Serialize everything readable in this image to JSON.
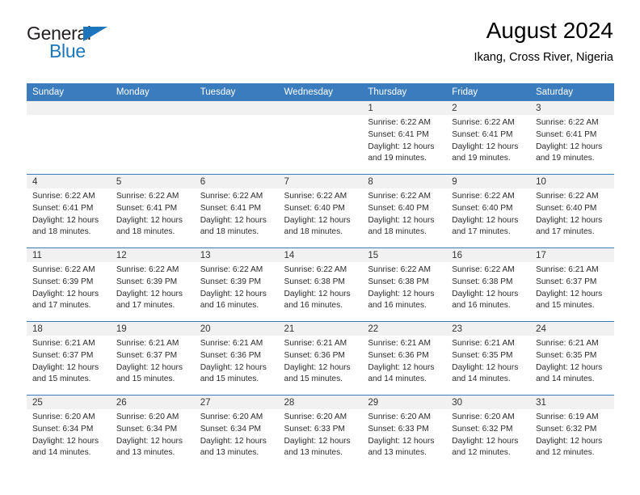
{
  "brand": {
    "name_part1": "General",
    "name_part2": "Blue",
    "triangle_icon": "blue-triangle-icon",
    "color_dark": "#231f20",
    "color_blue": "#1d76bc"
  },
  "header": {
    "title": "August 2024",
    "subtitle": "Ikang, Cross River, Nigeria"
  },
  "theme": {
    "header_row_bg": "#3a7cbe",
    "daynum_bg": "#f1f1f1",
    "grid_line": "#3a7cbe"
  },
  "weekday_headers": [
    "Sunday",
    "Monday",
    "Tuesday",
    "Wednesday",
    "Thursday",
    "Friday",
    "Saturday"
  ],
  "weeks": [
    [
      {
        "day": "",
        "empty": true,
        "sunrise": "",
        "sunset": "",
        "daylight1": "",
        "daylight2": ""
      },
      {
        "day": "",
        "empty": true,
        "sunrise": "",
        "sunset": "",
        "daylight1": "",
        "daylight2": ""
      },
      {
        "day": "",
        "empty": true,
        "sunrise": "",
        "sunset": "",
        "daylight1": "",
        "daylight2": ""
      },
      {
        "day": "",
        "empty": true,
        "sunrise": "",
        "sunset": "",
        "daylight1": "",
        "daylight2": ""
      },
      {
        "day": "1",
        "empty": false,
        "sunrise": "Sunrise: 6:22 AM",
        "sunset": "Sunset: 6:41 PM",
        "daylight1": "Daylight: 12 hours",
        "daylight2": "and 19 minutes."
      },
      {
        "day": "2",
        "empty": false,
        "sunrise": "Sunrise: 6:22 AM",
        "sunset": "Sunset: 6:41 PM",
        "daylight1": "Daylight: 12 hours",
        "daylight2": "and 19 minutes."
      },
      {
        "day": "3",
        "empty": false,
        "sunrise": "Sunrise: 6:22 AM",
        "sunset": "Sunset: 6:41 PM",
        "daylight1": "Daylight: 12 hours",
        "daylight2": "and 19 minutes."
      }
    ],
    [
      {
        "day": "4",
        "empty": false,
        "sunrise": "Sunrise: 6:22 AM",
        "sunset": "Sunset: 6:41 PM",
        "daylight1": "Daylight: 12 hours",
        "daylight2": "and 18 minutes."
      },
      {
        "day": "5",
        "empty": false,
        "sunrise": "Sunrise: 6:22 AM",
        "sunset": "Sunset: 6:41 PM",
        "daylight1": "Daylight: 12 hours",
        "daylight2": "and 18 minutes."
      },
      {
        "day": "6",
        "empty": false,
        "sunrise": "Sunrise: 6:22 AM",
        "sunset": "Sunset: 6:41 PM",
        "daylight1": "Daylight: 12 hours",
        "daylight2": "and 18 minutes."
      },
      {
        "day": "7",
        "empty": false,
        "sunrise": "Sunrise: 6:22 AM",
        "sunset": "Sunset: 6:40 PM",
        "daylight1": "Daylight: 12 hours",
        "daylight2": "and 18 minutes."
      },
      {
        "day": "8",
        "empty": false,
        "sunrise": "Sunrise: 6:22 AM",
        "sunset": "Sunset: 6:40 PM",
        "daylight1": "Daylight: 12 hours",
        "daylight2": "and 18 minutes."
      },
      {
        "day": "9",
        "empty": false,
        "sunrise": "Sunrise: 6:22 AM",
        "sunset": "Sunset: 6:40 PM",
        "daylight1": "Daylight: 12 hours",
        "daylight2": "and 17 minutes."
      },
      {
        "day": "10",
        "empty": false,
        "sunrise": "Sunrise: 6:22 AM",
        "sunset": "Sunset: 6:40 PM",
        "daylight1": "Daylight: 12 hours",
        "daylight2": "and 17 minutes."
      }
    ],
    [
      {
        "day": "11",
        "empty": false,
        "sunrise": "Sunrise: 6:22 AM",
        "sunset": "Sunset: 6:39 PM",
        "daylight1": "Daylight: 12 hours",
        "daylight2": "and 17 minutes."
      },
      {
        "day": "12",
        "empty": false,
        "sunrise": "Sunrise: 6:22 AM",
        "sunset": "Sunset: 6:39 PM",
        "daylight1": "Daylight: 12 hours",
        "daylight2": "and 17 minutes."
      },
      {
        "day": "13",
        "empty": false,
        "sunrise": "Sunrise: 6:22 AM",
        "sunset": "Sunset: 6:39 PM",
        "daylight1": "Daylight: 12 hours",
        "daylight2": "and 16 minutes."
      },
      {
        "day": "14",
        "empty": false,
        "sunrise": "Sunrise: 6:22 AM",
        "sunset": "Sunset: 6:38 PM",
        "daylight1": "Daylight: 12 hours",
        "daylight2": "and 16 minutes."
      },
      {
        "day": "15",
        "empty": false,
        "sunrise": "Sunrise: 6:22 AM",
        "sunset": "Sunset: 6:38 PM",
        "daylight1": "Daylight: 12 hours",
        "daylight2": "and 16 minutes."
      },
      {
        "day": "16",
        "empty": false,
        "sunrise": "Sunrise: 6:22 AM",
        "sunset": "Sunset: 6:38 PM",
        "daylight1": "Daylight: 12 hours",
        "daylight2": "and 16 minutes."
      },
      {
        "day": "17",
        "empty": false,
        "sunrise": "Sunrise: 6:21 AM",
        "sunset": "Sunset: 6:37 PM",
        "daylight1": "Daylight: 12 hours",
        "daylight2": "and 15 minutes."
      }
    ],
    [
      {
        "day": "18",
        "empty": false,
        "sunrise": "Sunrise: 6:21 AM",
        "sunset": "Sunset: 6:37 PM",
        "daylight1": "Daylight: 12 hours",
        "daylight2": "and 15 minutes."
      },
      {
        "day": "19",
        "empty": false,
        "sunrise": "Sunrise: 6:21 AM",
        "sunset": "Sunset: 6:37 PM",
        "daylight1": "Daylight: 12 hours",
        "daylight2": "and 15 minutes."
      },
      {
        "day": "20",
        "empty": false,
        "sunrise": "Sunrise: 6:21 AM",
        "sunset": "Sunset: 6:36 PM",
        "daylight1": "Daylight: 12 hours",
        "daylight2": "and 15 minutes."
      },
      {
        "day": "21",
        "empty": false,
        "sunrise": "Sunrise: 6:21 AM",
        "sunset": "Sunset: 6:36 PM",
        "daylight1": "Daylight: 12 hours",
        "daylight2": "and 15 minutes."
      },
      {
        "day": "22",
        "empty": false,
        "sunrise": "Sunrise: 6:21 AM",
        "sunset": "Sunset: 6:36 PM",
        "daylight1": "Daylight: 12 hours",
        "daylight2": "and 14 minutes."
      },
      {
        "day": "23",
        "empty": false,
        "sunrise": "Sunrise: 6:21 AM",
        "sunset": "Sunset: 6:35 PM",
        "daylight1": "Daylight: 12 hours",
        "daylight2": "and 14 minutes."
      },
      {
        "day": "24",
        "empty": false,
        "sunrise": "Sunrise: 6:21 AM",
        "sunset": "Sunset: 6:35 PM",
        "daylight1": "Daylight: 12 hours",
        "daylight2": "and 14 minutes."
      }
    ],
    [
      {
        "day": "25",
        "empty": false,
        "sunrise": "Sunrise: 6:20 AM",
        "sunset": "Sunset: 6:34 PM",
        "daylight1": "Daylight: 12 hours",
        "daylight2": "and 14 minutes."
      },
      {
        "day": "26",
        "empty": false,
        "sunrise": "Sunrise: 6:20 AM",
        "sunset": "Sunset: 6:34 PM",
        "daylight1": "Daylight: 12 hours",
        "daylight2": "and 13 minutes."
      },
      {
        "day": "27",
        "empty": false,
        "sunrise": "Sunrise: 6:20 AM",
        "sunset": "Sunset: 6:34 PM",
        "daylight1": "Daylight: 12 hours",
        "daylight2": "and 13 minutes."
      },
      {
        "day": "28",
        "empty": false,
        "sunrise": "Sunrise: 6:20 AM",
        "sunset": "Sunset: 6:33 PM",
        "daylight1": "Daylight: 12 hours",
        "daylight2": "and 13 minutes."
      },
      {
        "day": "29",
        "empty": false,
        "sunrise": "Sunrise: 6:20 AM",
        "sunset": "Sunset: 6:33 PM",
        "daylight1": "Daylight: 12 hours",
        "daylight2": "and 13 minutes."
      },
      {
        "day": "30",
        "empty": false,
        "sunrise": "Sunrise: 6:20 AM",
        "sunset": "Sunset: 6:32 PM",
        "daylight1": "Daylight: 12 hours",
        "daylight2": "and 12 minutes."
      },
      {
        "day": "31",
        "empty": false,
        "sunrise": "Sunrise: 6:19 AM",
        "sunset": "Sunset: 6:32 PM",
        "daylight1": "Daylight: 12 hours",
        "daylight2": "and 12 minutes."
      }
    ]
  ]
}
